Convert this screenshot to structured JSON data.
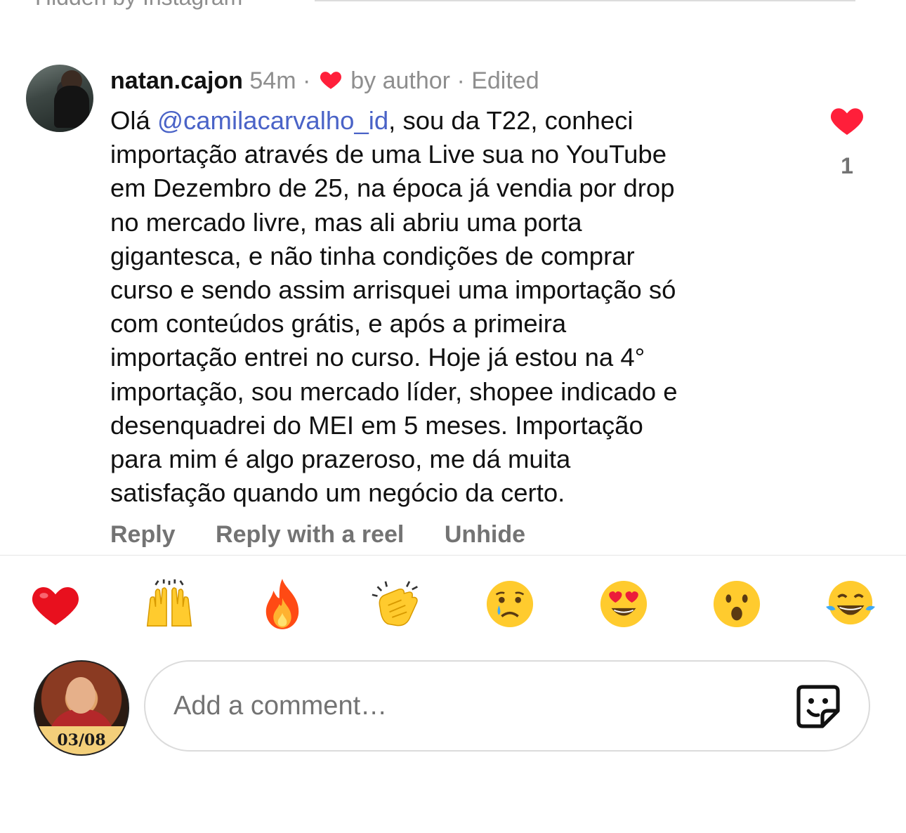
{
  "top_note": "Hidden by Instagram",
  "comment": {
    "username": "natan.cajon",
    "time": "54m",
    "separator": "·",
    "by_author": "by author",
    "edited": "Edited",
    "mention": "@camilacarvalho_id",
    "lines": [
      "Olá ",
      "importação através de uma Live sua no YouTube",
      "em Dezembro de 25, na época já vendia por drop",
      "no mercado livre, mas ali abriu uma porta",
      "gigantesca, e não tinha condições de comprar",
      "curso e sendo assim arrisquei uma importação só",
      "com conteúdos grátis, e após a primeira",
      "importação entrei no curso. Hoje já estou na 4°",
      "importação, sou mercado líder, shopee indicado e",
      "desenquadrei do MEI em 5 meses. Importação",
      "para mim é algo prazeroso, me dá muita",
      "satisfação quando um negócio da certo."
    ],
    "line1_after_mention": ", sou da T22, conheci",
    "like_count": "1",
    "actions": {
      "reply": "Reply",
      "reply_reel": "Reply with a reel",
      "unhide": "Unhide"
    }
  },
  "reactions": [
    "heart",
    "raised-hands",
    "fire",
    "clapping-hands",
    "crying-face",
    "heart-eyes-face",
    "surprised-face",
    "tears-of-joy-face"
  ],
  "composer": {
    "avatar_badge": "03/08",
    "placeholder": "Add a comment…"
  },
  "colors": {
    "mention": "#4a63c7",
    "like": "#ff3040",
    "muted": "#737373"
  }
}
